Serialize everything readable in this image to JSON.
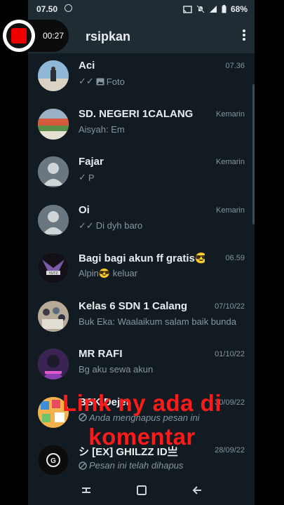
{
  "status": {
    "time": "07.50",
    "battery": "68%"
  },
  "appbar": {
    "title": "rsipkan"
  },
  "recorder": {
    "timer": "00:27"
  },
  "chats": [
    {
      "name": "Aci",
      "time": "07.36",
      "preview": "Foto",
      "ticks": "✓✓",
      "media": "photo-icon"
    },
    {
      "name": "SD. NEGERI 1CALANG",
      "time": "Kemarin",
      "preview": "Aisyah: Em"
    },
    {
      "name": "Fajar",
      "time": "Kemarin",
      "preview": "P",
      "ticks": "✓"
    },
    {
      "name": "Oi",
      "time": "Kemarin",
      "preview": "Di dyh baro",
      "ticks": "✓✓"
    },
    {
      "name": "Bagi bagi akun ff gratis😎",
      "time": "06.59",
      "preview": "Alpin😎 keluar"
    },
    {
      "name": "Kelas 6 SDN 1 Calang",
      "time": "07/10/22",
      "preview": "Buk Eka: Waalaikum salam baik bunda"
    },
    {
      "name": "MR RAFI",
      "time": "01/10/22",
      "preview": "Bg aku sewa akun"
    },
    {
      "name": "BSK Dejet",
      "time": "30/09/22",
      "preview": "Anda menghapus pesan ini",
      "deleted": true
    },
    {
      "name": "シ [EX] GHILZZ ID亗",
      "time": "28/09/22",
      "preview": "Pesan ini telah dihapus",
      "deleted": true
    }
  ],
  "overlay": {
    "line1": "Link ny ada di",
    "line2": "komentar"
  },
  "colors": {
    "background": "#111b21",
    "header": "#1f2c34",
    "overlay_text": "#ff1a1a"
  }
}
